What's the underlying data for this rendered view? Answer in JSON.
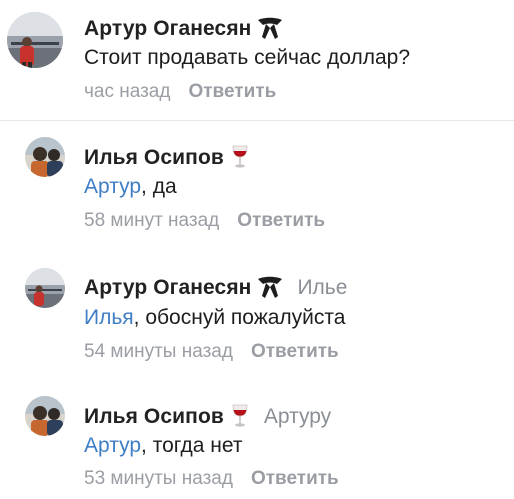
{
  "comments": [
    {
      "author": "Артур Оганесян",
      "badge_icon": "black-bow-tie-icon",
      "reply_to": "",
      "mention": "",
      "text": "Стоит продавать сейчас доллар?",
      "time": "час назад",
      "reply_label": "Ответить"
    },
    {
      "author": "Илья Осипов",
      "badge_icon": "wine-glass-icon",
      "reply_to": "",
      "mention": "Артур",
      "text": ", да",
      "time": "58 минут назад",
      "reply_label": "Ответить"
    },
    {
      "author": "Артур Оганесян",
      "badge_icon": "black-bow-tie-icon",
      "reply_to": "Илье",
      "mention": "Илья",
      "text": ", обоснуй пожалуйста",
      "time": "54 минуты назад",
      "reply_label": "Ответить"
    },
    {
      "author": "Илья Осипов",
      "badge_icon": "wine-glass-icon",
      "reply_to": "Артуру",
      "mention": "Артур",
      "text": ", тогда нет",
      "time": "53 минуты назад",
      "reply_label": "Ответить"
    }
  ],
  "colors": {
    "link": "#3f7ec4",
    "muted": "#9a9ea4",
    "text": "#1e1e1e",
    "divider": "#e6e7ea"
  }
}
